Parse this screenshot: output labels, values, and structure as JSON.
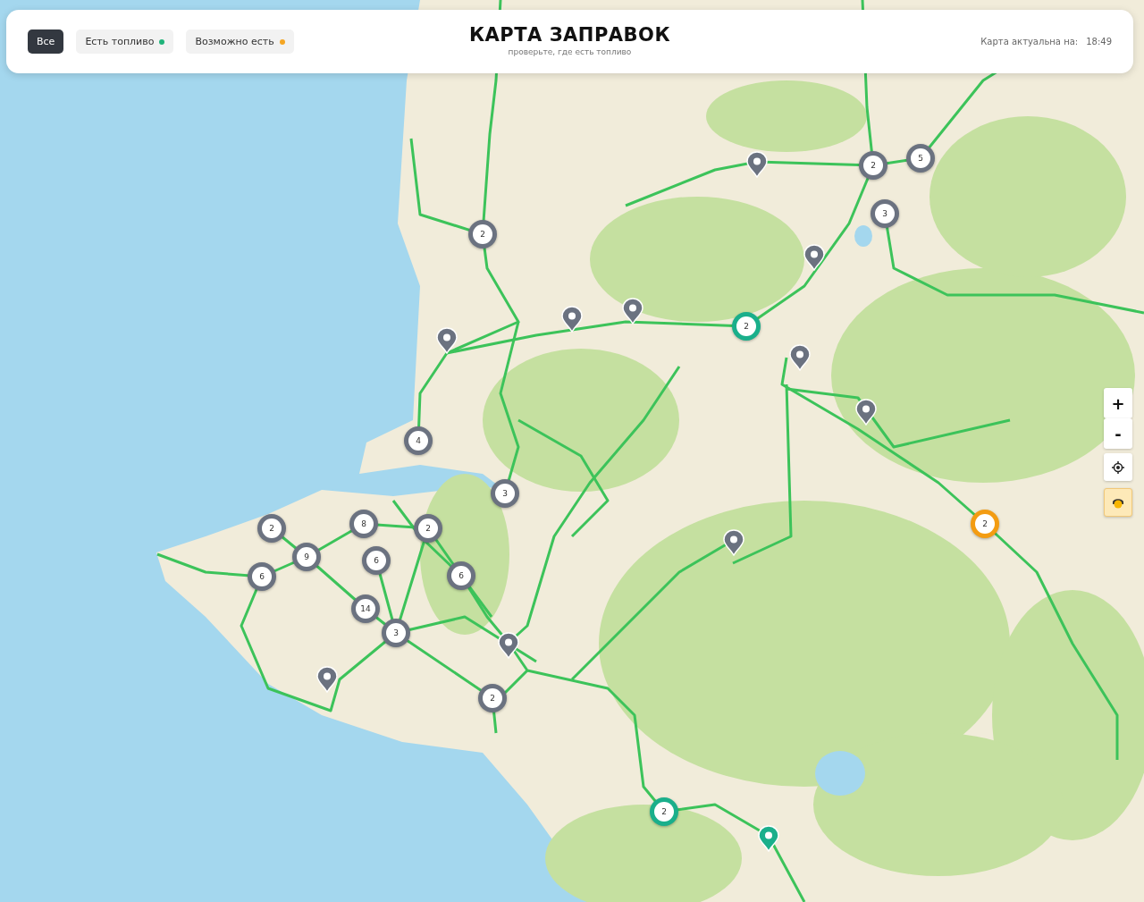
{
  "header": {
    "filters": [
      {
        "label": "Все",
        "selected": true
      },
      {
        "label": "Есть топливо",
        "selected": false,
        "color": "#1fb37a"
      },
      {
        "label": "Возможно есть",
        "selected": false,
        "color": "#f5a623"
      }
    ],
    "title": "КАРТА ЗАПРАВОК",
    "subtitle": "проверьте, где есть топливо",
    "updated_label": "Карта актуальна на:",
    "updated_time": "18:49"
  },
  "map": {
    "clusters": [
      {
        "label": "2",
        "color": "#6b7280"
      },
      {
        "label": "2",
        "color": "#6b7280"
      },
      {
        "label": "5",
        "color": "#6b7280"
      },
      {
        "label": "3",
        "color": "#6b7280"
      },
      {
        "label": "2",
        "color": "#1aaf8b"
      },
      {
        "label": "4",
        "color": "#6b7280"
      },
      {
        "label": "3",
        "color": "#6b7280"
      },
      {
        "label": "2",
        "color": "#6b7280"
      },
      {
        "label": "8",
        "color": "#6b7280"
      },
      {
        "label": "2",
        "color": "#6b7280"
      },
      {
        "label": "9",
        "color": "#6b7280"
      },
      {
        "label": "6",
        "color": "#6b7280"
      },
      {
        "label": "6",
        "color": "#6b7280"
      },
      {
        "label": "6",
        "color": "#6b7280"
      },
      {
        "label": "14",
        "color": "#6b7280"
      },
      {
        "label": "3",
        "color": "#6b7280"
      },
      {
        "label": "2",
        "color": "#6b7280"
      },
      {
        "label": "2",
        "color": "#f39c12"
      },
      {
        "label": "2",
        "color": "#1aaf8b"
      }
    ],
    "pins": [
      {
        "color": "#6b7280"
      },
      {
        "color": "#6b7280"
      },
      {
        "color": "#6b7280"
      },
      {
        "color": "#6b7280"
      },
      {
        "color": "#6b7280"
      },
      {
        "color": "#6b7280"
      },
      {
        "color": "#6b7280"
      },
      {
        "color": "#6b7280"
      },
      {
        "color": "#6b7280"
      },
      {
        "color": "#6b7280"
      },
      {
        "color": "#1aaf8b"
      }
    ],
    "zoom_in": "+",
    "zoom_out": "-"
  }
}
